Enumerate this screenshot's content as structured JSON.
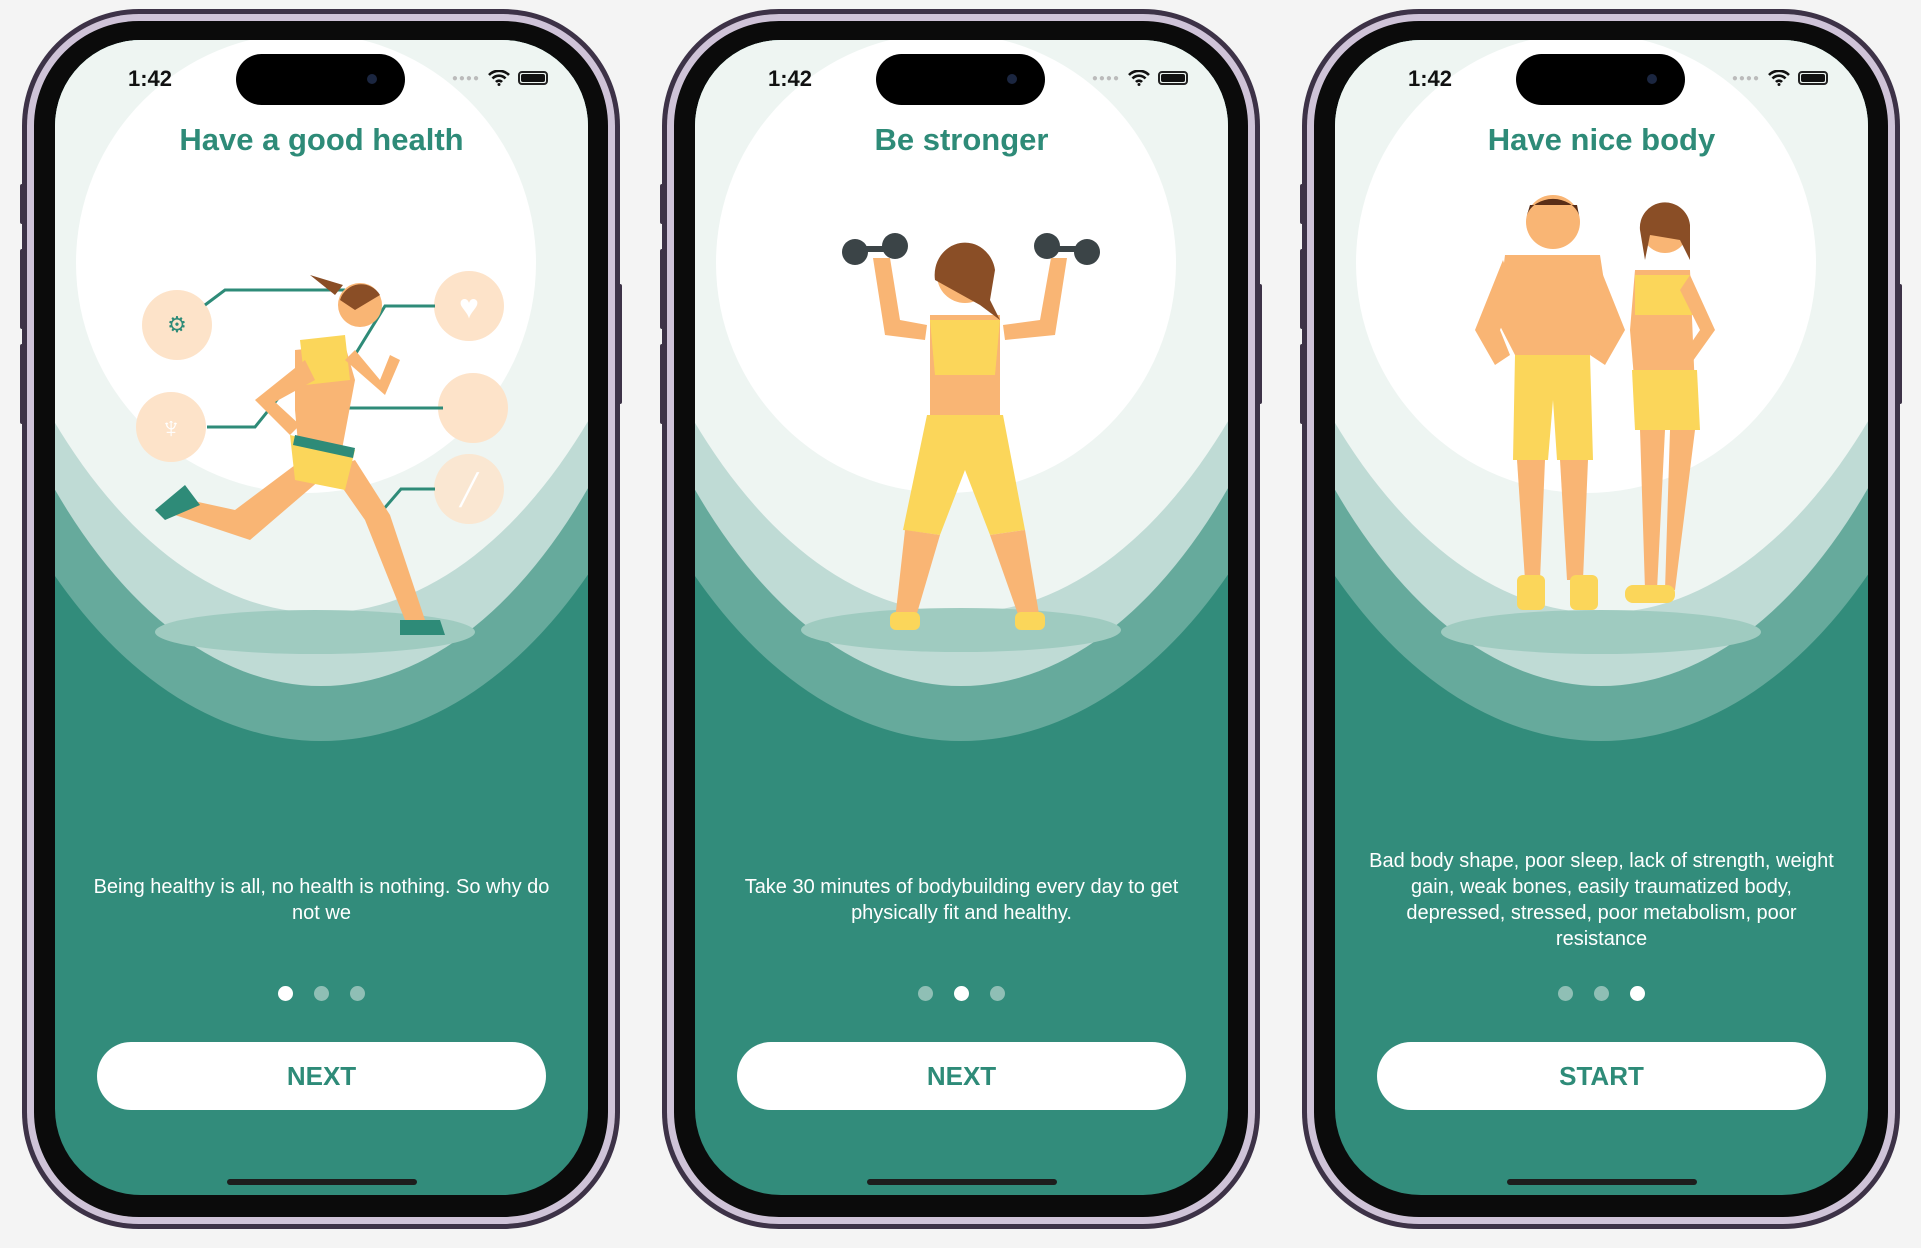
{
  "colors": {
    "primary": "#328c7b",
    "title": "#2e8b78",
    "band_light": "#bfdbd5",
    "band_mid": "#66aa9c",
    "background_top": "#eef5f2"
  },
  "screens": [
    {
      "status_time": "1:42",
      "title": "Have a good health",
      "description": "Being healthy is all, no health is nothing. So why do not we",
      "button_label": "NEXT",
      "active_page": 1,
      "page_count": 3,
      "illustration": "runner-with-organ-icons"
    },
    {
      "status_time": "1:42",
      "title": "Be stronger",
      "description": "Take 30 minutes of bodybuilding every day to get physically fit and healthy.",
      "button_label": "NEXT",
      "active_page": 2,
      "page_count": 3,
      "illustration": "woman-lifting-dumbbells"
    },
    {
      "status_time": "1:42",
      "title": "Have nice body",
      "description": "Bad body shape, poor sleep, lack of strength, weight gain, weak bones, easily traumatized body, depressed, stressed, poor metabolism, poor resistance",
      "button_label": "START",
      "active_page": 3,
      "page_count": 3,
      "illustration": "fit-couple"
    }
  ]
}
